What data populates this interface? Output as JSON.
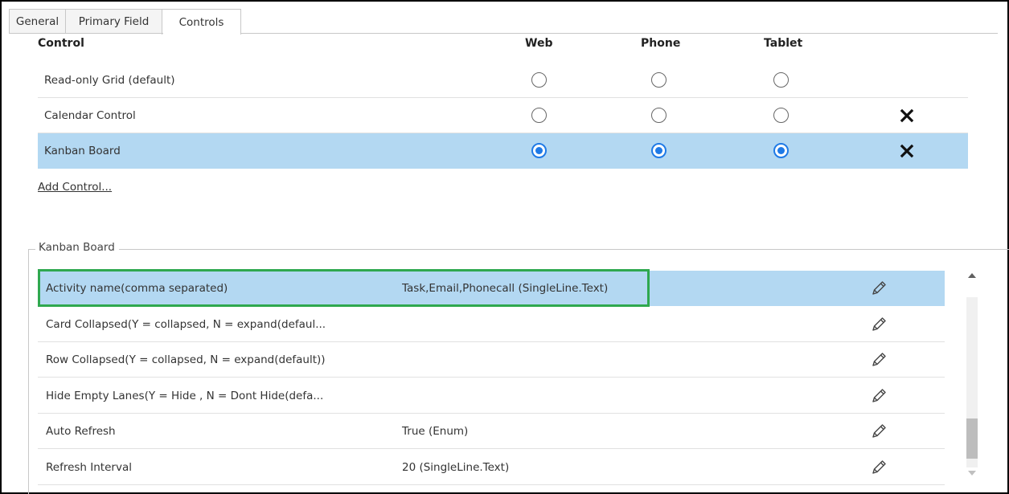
{
  "tabs": [
    {
      "label": "General"
    },
    {
      "label": "Primary Field"
    },
    {
      "label": "Controls"
    }
  ],
  "active_tab": "Controls",
  "grid": {
    "headers": {
      "control": "Control",
      "web": "Web",
      "phone": "Phone",
      "tablet": "Tablet"
    },
    "rows": [
      {
        "name": "Read-only Grid (default)",
        "web": false,
        "phone": false,
        "tablet": false,
        "removable": false,
        "selected": false
      },
      {
        "name": "Calendar Control",
        "web": false,
        "phone": false,
        "tablet": false,
        "removable": true,
        "selected": false
      },
      {
        "name": "Kanban Board",
        "web": true,
        "phone": true,
        "tablet": true,
        "removable": true,
        "selected": true
      }
    ],
    "add_control_label": "Add Control..."
  },
  "properties": {
    "legend": "Kanban Board",
    "rows": [
      {
        "name": "Activity name(comma separated)",
        "value": "Task,Email,Phonecall (SingleLine.Text)",
        "selected": true
      },
      {
        "name": "Card Collapsed(Y = collapsed, N = expand(defaul...",
        "value": "",
        "selected": false
      },
      {
        "name": "Row Collapsed(Y = collapsed, N = expand(default))",
        "value": "",
        "selected": false
      },
      {
        "name": "Hide Empty Lanes(Y = Hide , N = Dont Hide(defa...",
        "value": "",
        "selected": false
      },
      {
        "name": "Auto Refresh",
        "value": "True (Enum)",
        "selected": false
      },
      {
        "name": "Refresh Interval",
        "value": "20 (SingleLine.Text)",
        "selected": false
      }
    ]
  },
  "icons": {
    "delete": "close-x-icon",
    "edit": "pencil-icon",
    "scroll_up": "scroll-up-arrow-icon",
    "scroll_down": "scroll-down-arrow-icon"
  },
  "colors": {
    "selected_row": "#b3d8f2",
    "radio_checked": "#1f7ae6",
    "highlight_border": "#2fa84f"
  }
}
